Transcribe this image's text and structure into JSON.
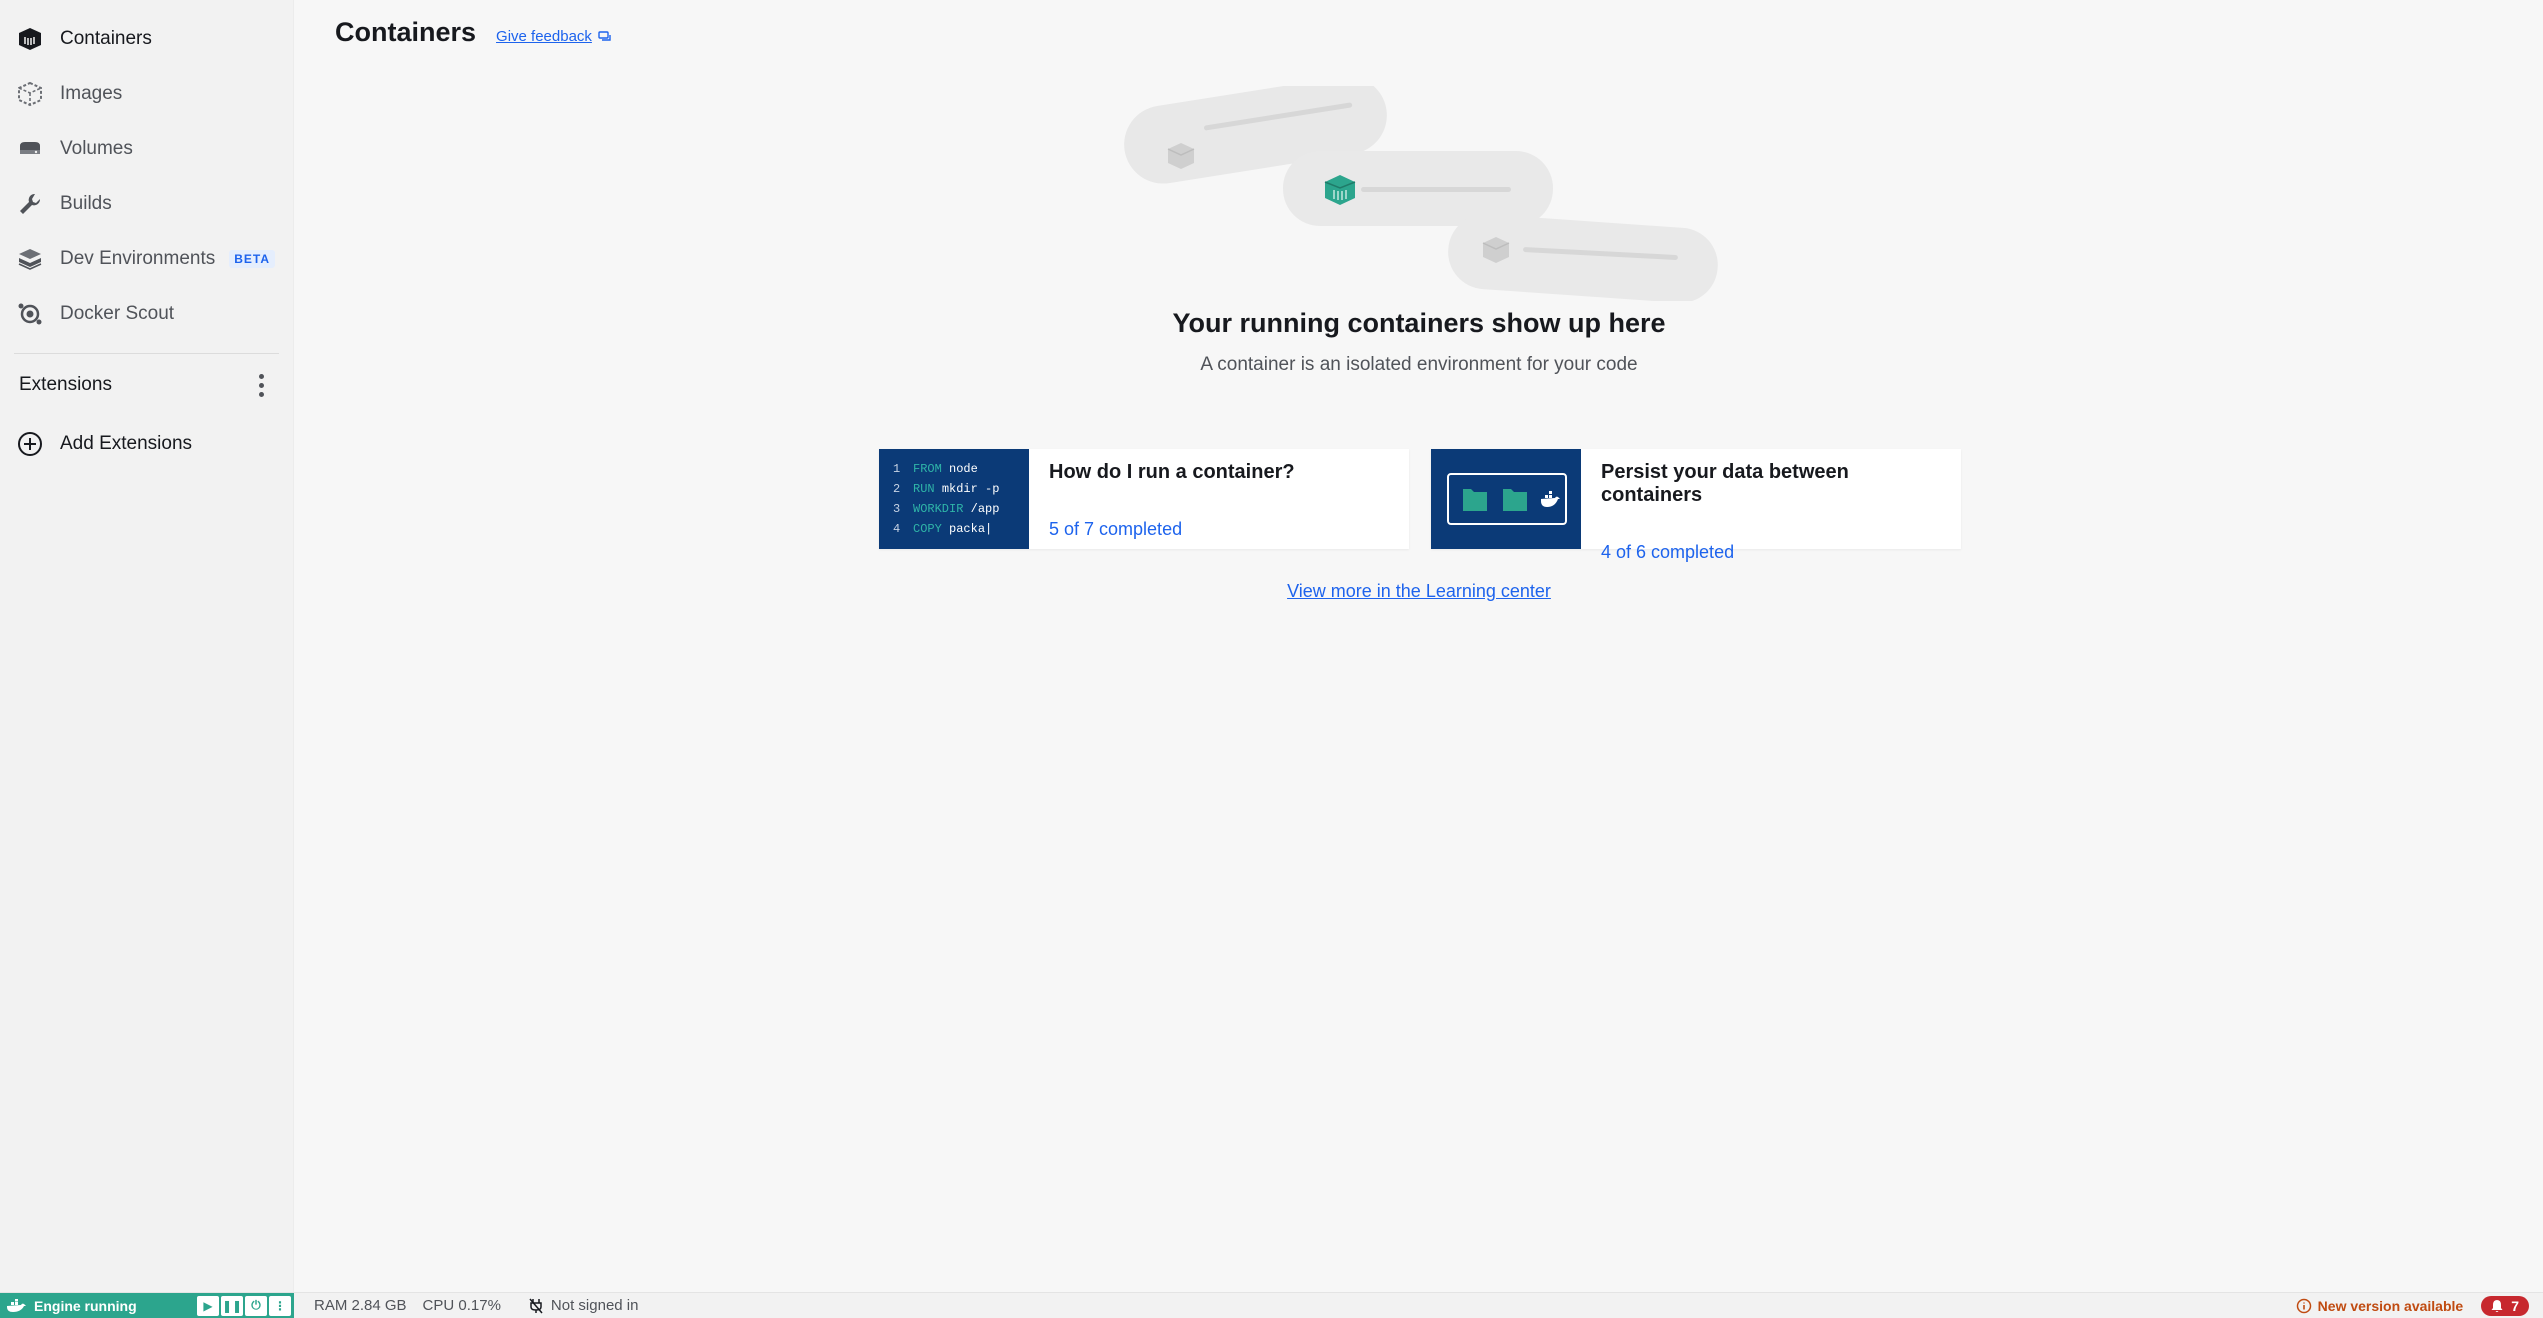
{
  "sidebar": {
    "items": [
      {
        "label": "Containers",
        "icon": "containers-icon",
        "active": true
      },
      {
        "label": "Images",
        "icon": "images-icon"
      },
      {
        "label": "Volumes",
        "icon": "volumes-icon"
      },
      {
        "label": "Builds",
        "icon": "wrench-icon"
      },
      {
        "label": "Dev Environments",
        "icon": "dev-environments-icon",
        "badge": "BETA"
      },
      {
        "label": "Docker Scout",
        "icon": "scout-icon"
      }
    ],
    "extensions_label": "Extensions",
    "add_extensions_label": "Add Extensions"
  },
  "header": {
    "title": "Containers",
    "feedback_label": "Give feedback"
  },
  "empty_state": {
    "title": "Your running containers show up here",
    "subtitle": "A container is an isolated environment for your code"
  },
  "cards": [
    {
      "title": "How do I run a container?",
      "progress": "5 of 7 completed",
      "code_lines": [
        {
          "n": "1",
          "kw": "FROM",
          "rest": "node"
        },
        {
          "n": "2",
          "kw": "RUN",
          "rest": "mkdir -p"
        },
        {
          "n": "3",
          "kw": "WORKDIR",
          "rest": "/app"
        },
        {
          "n": "4",
          "kw": "COPY",
          "rest": "packa"
        }
      ]
    },
    {
      "title": "Persist your data between containers",
      "progress": "4 of 6 completed"
    }
  ],
  "learning_link": "View more in the Learning center",
  "statusbar": {
    "engine": "Engine running",
    "ram": "RAM 2.84 GB",
    "cpu": "CPU 0.17%",
    "signed_in": "Not signed in",
    "new_version": "New version available",
    "notifications": "7"
  },
  "colors": {
    "accent": "#1d63ed",
    "engine_green": "#2ca58d",
    "card_thumb": "#0b3a77",
    "notification_red": "#c7282e"
  }
}
